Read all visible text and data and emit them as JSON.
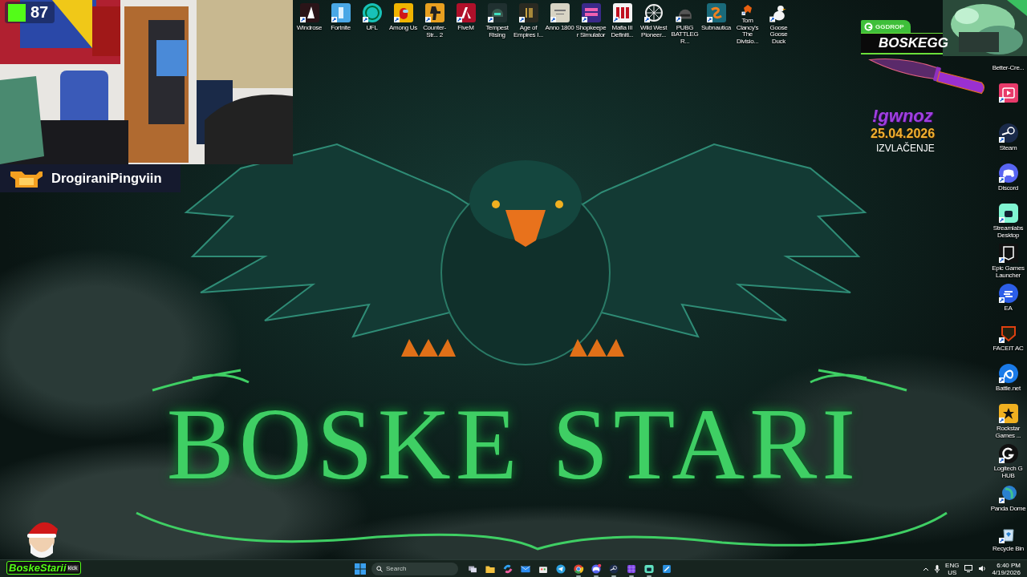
{
  "stream_overlay": {
    "viewer_count": "87",
    "streamer_name": "DrogiraniPingviin",
    "channel_badge": {
      "name": "BoskeStarii",
      "platform": "kick"
    }
  },
  "giveaway": {
    "sponsor": "GGDROP",
    "code": "BOSKEGG",
    "command": "!gwnoz",
    "date": "25.04.2026",
    "caption": "IZVLAČENJE"
  },
  "wallpaper": {
    "title": "BOSKE STARI"
  },
  "desktop_icons_top": [
    {
      "label": "Windrose"
    },
    {
      "label": "Fortnite"
    },
    {
      "label": "UFL"
    },
    {
      "label": "Among Us"
    },
    {
      "label": "Counter-Str... 2"
    },
    {
      "label": "FiveM"
    },
    {
      "label": "Tempest Rising"
    },
    {
      "label": "Age of Empires I..."
    },
    {
      "label": "Anno 1800"
    },
    {
      "label": "Shopkeeper Simulator"
    },
    {
      "label": "Mafia III Definiti..."
    },
    {
      "label": "Wild West Pioneer..."
    },
    {
      "label": "PUBG BATTLEGR..."
    },
    {
      "label": "Subnautica"
    },
    {
      "label": "Tom Clancy's The Divisio..."
    },
    {
      "label": "Goose Goose Duck"
    }
  ],
  "desktop_icons_right": [
    {
      "kind": "label_only",
      "label": "Better-Cre..."
    },
    {
      "kind": "icon_only"
    },
    {
      "label": "Steam"
    },
    {
      "label": "Discord"
    },
    {
      "label": "Streamlabs Desktop"
    },
    {
      "label": "Epic Games Launcher"
    },
    {
      "label": "EA"
    },
    {
      "label": "FACEIT AC"
    },
    {
      "label": "Battle.net"
    },
    {
      "label": "Rockstar Games ..."
    },
    {
      "label": "Logitech G HUB"
    },
    {
      "label": "Panda Dome"
    },
    {
      "label": "Recycle Bin"
    }
  ],
  "taskbar": {
    "search": {
      "placeholder": "Search"
    },
    "apps": [
      {
        "running": false
      },
      {
        "running": false
      },
      {
        "running": false
      },
      {
        "running": false
      },
      {
        "running": false
      },
      {
        "running": false
      },
      {
        "running": true
      },
      {
        "running": true
      },
      {
        "running": true
      },
      {
        "running": true
      },
      {
        "running": true
      },
      {
        "running": false
      }
    ],
    "language": "ENG",
    "region": "US",
    "time": "6:40 PM",
    "date": "4/19/2026"
  }
}
